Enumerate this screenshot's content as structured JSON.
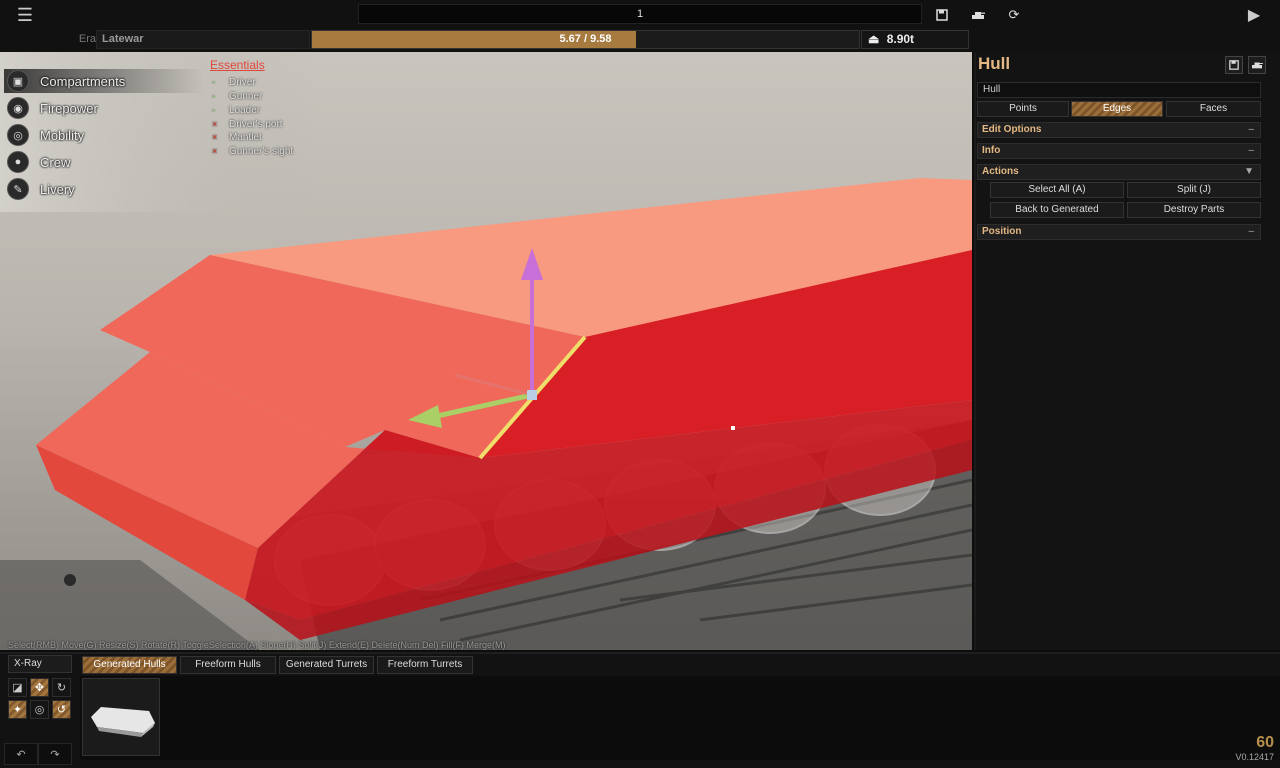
{
  "topbar": {
    "menu_icon": "hamburger-icon",
    "vehicle_name": "1",
    "save_icon": "floppy-disk-icon",
    "export_icon": "tank-icon",
    "reset_icon": "refresh-icon",
    "play_icon": "play-icon",
    "era_label": "Era",
    "era_value": "Latewar",
    "cost_text": "5.67 / 9.58",
    "cost_fraction": 0.592,
    "weight_icon": "weight-icon",
    "weight_value": "8.90t"
  },
  "categories": [
    {
      "label": "Compartments",
      "icon": "box-icon"
    },
    {
      "label": "Firepower",
      "icon": "gun-icon"
    },
    {
      "label": "Mobility",
      "icon": "wheel-icon"
    },
    {
      "label": "Crew",
      "icon": "person-icon"
    },
    {
      "label": "Livery",
      "icon": "brush-icon"
    }
  ],
  "essentials": {
    "title": "Essentials",
    "items": [
      {
        "name": "Driver",
        "mark": "-",
        "ok": true
      },
      {
        "name": "Gunner",
        "mark": "-",
        "ok": true
      },
      {
        "name": "Loader",
        "mark": "-",
        "ok": true
      },
      {
        "name": "Driver's port",
        "mark": "×",
        "ok": false
      },
      {
        "name": "Mantlet",
        "mark": "×",
        "ok": false
      },
      {
        "name": "Gunner's sight",
        "mark": "×",
        "ok": false
      }
    ]
  },
  "hint": "Select(RMB) Move(G) Resize(S) Rotate(R) ToggleSelection(A) Slope(H) Split(J) Extend(E) Delete(Num Del) Fill(F) Merge(M)",
  "panel": {
    "title": "Hull",
    "part_value": "Hull",
    "tabs": [
      "Points",
      "Edges",
      "Faces"
    ],
    "sections": {
      "edit_options": "Edit Options",
      "info": "Info",
      "actions": "Actions",
      "position": "Position",
      "collapse": "–",
      "expand": "▼"
    },
    "actions": {
      "select_all": "Select All (A)",
      "split": "Split (J)",
      "back": "Back to Generated",
      "destroy": "Destroy Parts"
    }
  },
  "bottom": {
    "xray": "X-Ray",
    "tabs": [
      "Generated Hulls",
      "Freeform Hulls",
      "Generated Turrets",
      "Freeform Turrets"
    ],
    "undo": "↶",
    "redo": "↷",
    "fps": "60",
    "version": "V0.12417"
  }
}
